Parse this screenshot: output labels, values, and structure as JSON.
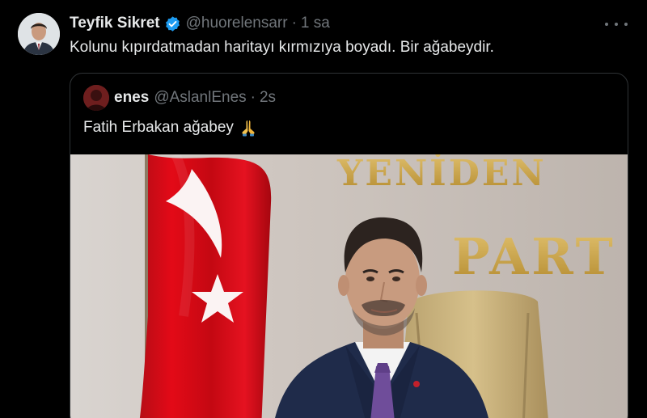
{
  "tweet": {
    "author_name": "Teyfik Sikret",
    "author_handle": "@huorelensarr",
    "separator": "·",
    "time": "1 sa",
    "text": "Kolunu kıpırdatmadan haritayı kırmızıya boyadı. Bir ağabeydir."
  },
  "quoted_tweet": {
    "author_name": "enes",
    "author_handle": "@AslanlEnes",
    "separator": "·",
    "time": "2s",
    "text": "Fatih Erbakan ağabey"
  },
  "media": {
    "sign_line1": "YENİDEN",
    "sign_line2": "PART"
  },
  "colors": {
    "background": "#000000",
    "primary_text": "#e7e9ea",
    "secondary_text": "#71767b",
    "verified_blue": "#1d9bf0",
    "border": "#2f3336",
    "flag_red": "#e30a17"
  },
  "icons": {
    "verified": "verified-badge-icon",
    "more": "more-options-icon",
    "emoji": "folded-hands-emoji"
  }
}
